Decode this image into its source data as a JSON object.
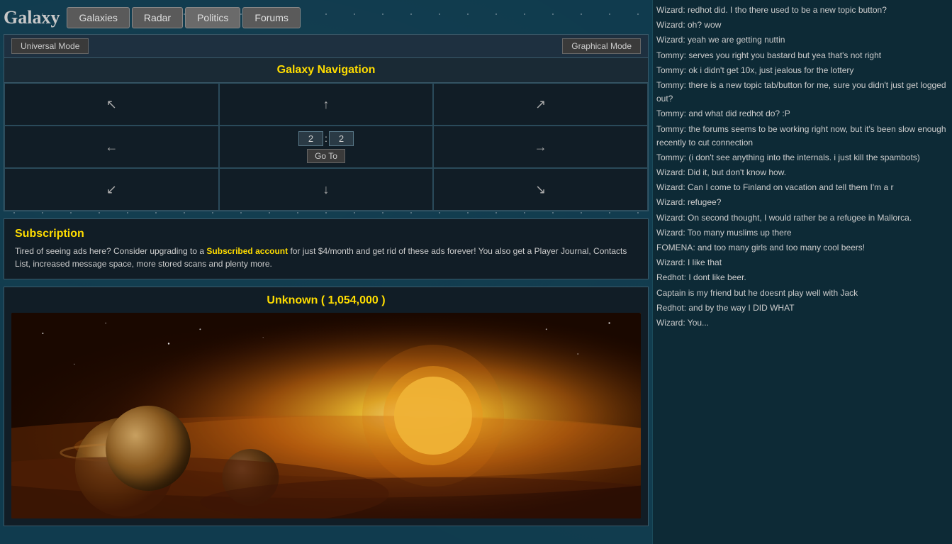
{
  "header": {
    "title": "Galaxy",
    "tabs": [
      {
        "label": "Galaxies",
        "id": "galaxies"
      },
      {
        "label": "Radar",
        "id": "radar"
      },
      {
        "label": "Politics",
        "id": "politics"
      },
      {
        "label": "Forums",
        "id": "forums"
      }
    ]
  },
  "modes": {
    "universal": "Universal Mode",
    "graphical": "Graphical Mode"
  },
  "galaxyNav": {
    "title": "Galaxy Navigation",
    "coords": {
      "x": "2",
      "separator": ":",
      "y": "2"
    },
    "gotoLabel": "Go To",
    "arrows": {
      "nw": "↖",
      "n": "↑",
      "ne": "↗",
      "w": "←",
      "e": "→",
      "sw": "↙",
      "s": "↓",
      "se": "↘"
    }
  },
  "subscription": {
    "title": "Subscription",
    "text_before": "Tired of seeing ads here? Consider upgrading to a ",
    "link_text": "Subscribed account",
    "text_after": " for just $4/month and get rid of these ads forever! You also get a Player Journal, Contacts List, increased message space, more stored scans and plenty more."
  },
  "galaxyImage": {
    "title": "Unknown ( 1,054,000 )"
  },
  "chat": {
    "messages": [
      {
        "text": "Wizard: redhot did. I tho there used to be a new topic button?"
      },
      {
        "text": "Wizard: oh? wow"
      },
      {
        "text": "Wizard: yeah we are getting nuttin"
      },
      {
        "text": "Tommy: serves you right you bastard but yea that's not right"
      },
      {
        "text": "Tommy: ok i didn't get 10x, just jealous for the lottery"
      },
      {
        "text": "Tommy: there is a new topic tab/button for me, sure you didn't just get logged out?"
      },
      {
        "text": "Tommy: and what did redhot do? :P"
      },
      {
        "text": "Tommy: the forums seems to be working right now, but it's been slow enough recently to cut connection"
      },
      {
        "text": "Tommy: (i don't see anything into the internals. i just kill the spambots)"
      },
      {
        "text": "Wizard: Did it, but don't know how."
      },
      {
        "text": "Wizard: Can I come to Finland on vacation and tell them I'm a r"
      },
      {
        "text": "Wizard: refugee?"
      },
      {
        "text": "Wizard: On second thought, I would rather be a refugee in Mallorca."
      },
      {
        "text": "Wizard: Too many muslims up there"
      },
      {
        "text": "FOMENA: and too many girls and too many cool beers!"
      },
      {
        "text": "Wizard: I like that"
      },
      {
        "text": "Redhot: I dont like beer."
      },
      {
        "text": "Captain is my friend but he doesnt play well with Jack"
      },
      {
        "text": "Redhot: and by the way I DID WHAT"
      },
      {
        "text": "Wizard: You..."
      }
    ]
  }
}
